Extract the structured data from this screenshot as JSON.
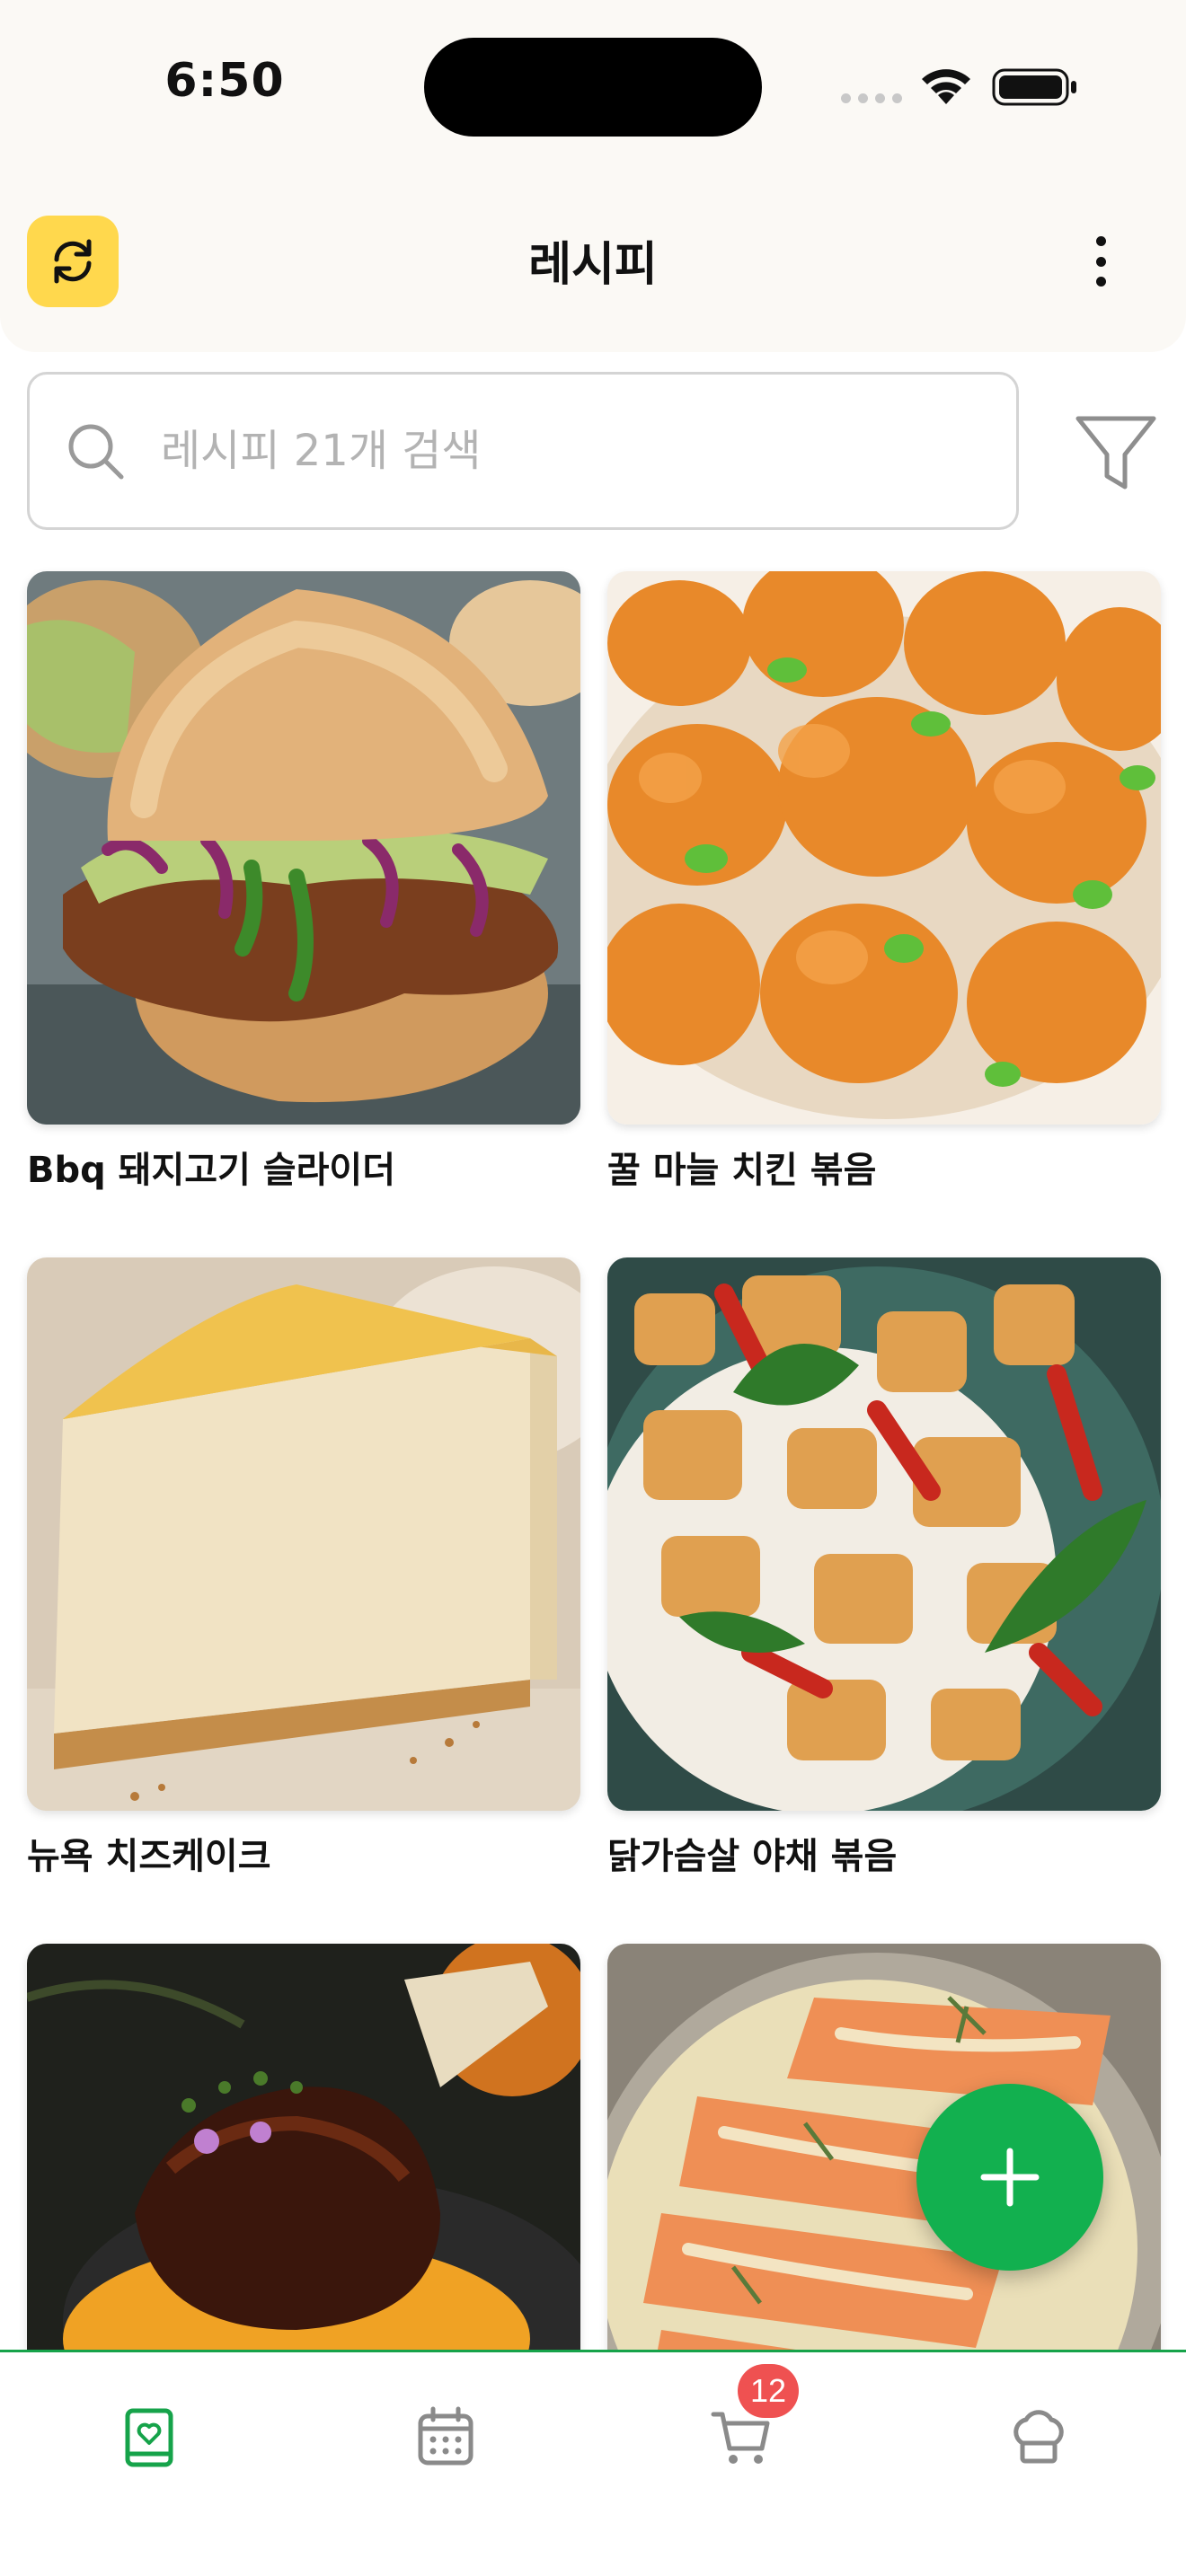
{
  "status_bar": {
    "time": "6:50"
  },
  "header": {
    "title": "레시피",
    "refresh_icon": "refresh-icon",
    "more_icon": "more-vertical-icon"
  },
  "search": {
    "placeholder": "레시피 21개 검색",
    "value": "",
    "icon": "search-icon",
    "filter_icon": "filter-icon"
  },
  "recipes": [
    {
      "title": "Bbq 돼지고기 슬라이더"
    },
    {
      "title": "꿀 마늘 치킨 볶음"
    },
    {
      "title": "뉴욕 치즈케이크"
    },
    {
      "title": "닭가슴살 야채 볶음"
    },
    {
      "title": ""
    },
    {
      "title": ""
    }
  ],
  "fab": {
    "icon": "plus-icon"
  },
  "tabs": [
    {
      "icon": "recipe-book-icon",
      "active": true
    },
    {
      "icon": "calendar-icon",
      "active": false
    },
    {
      "icon": "cart-icon",
      "active": false,
      "badge": "12"
    },
    {
      "icon": "chef-hat-icon",
      "active": false
    }
  ],
  "colors": {
    "accent": "#16a34a",
    "fab": "#12b04f",
    "refresh_bg": "#ffd84d",
    "badge": "#ef5151"
  }
}
